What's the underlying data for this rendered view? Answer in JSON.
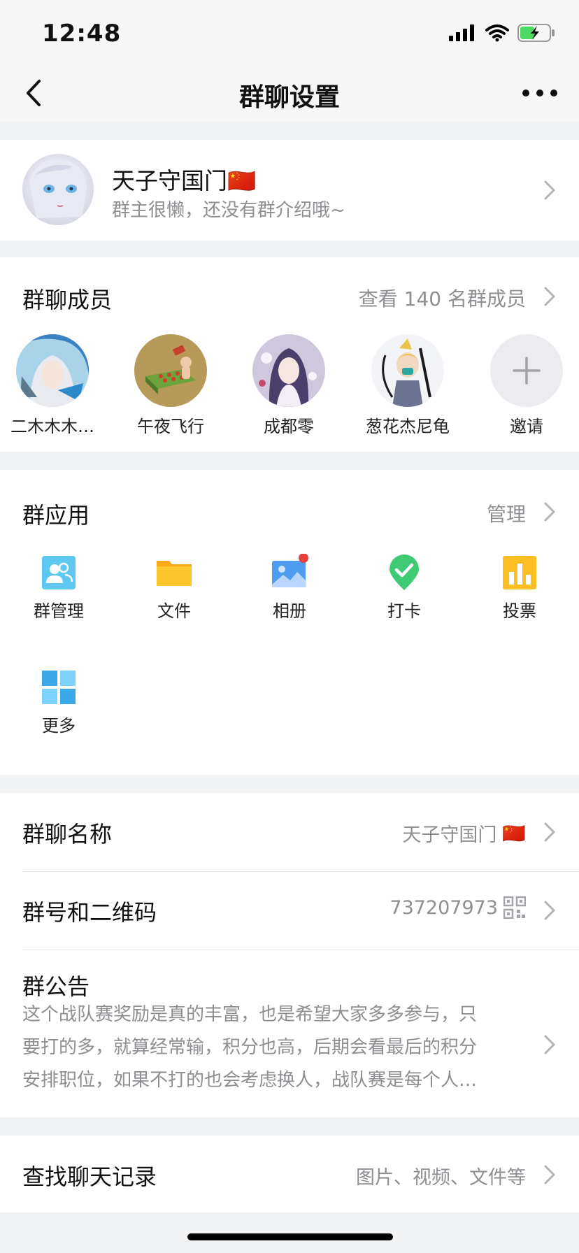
{
  "status_bar": {
    "time": "12:48"
  },
  "nav": {
    "title": "群聊设置",
    "back_icon": "chevron-left-icon",
    "more_icon": "more-dots-icon"
  },
  "group": {
    "name": "天子守国门",
    "flag": "🇨🇳",
    "intro": "群主很懒，还没有群介绍哦~"
  },
  "members": {
    "title": "群聊成员",
    "view_all": "查看 140 名群成员",
    "list": [
      {
        "name": "二木木木…"
      },
      {
        "name": "午夜飞行"
      },
      {
        "name": "成都零"
      },
      {
        "name": "葱花杰尼龟"
      },
      {
        "name": "邀请"
      }
    ]
  },
  "apps": {
    "title": "群应用",
    "manage": "管理",
    "items": [
      {
        "label": "群管理",
        "icon": "group-manage-icon"
      },
      {
        "label": "文件",
        "icon": "folder-icon"
      },
      {
        "label": "相册",
        "icon": "photo-album-icon"
      },
      {
        "label": "打卡",
        "icon": "checkin-icon"
      },
      {
        "label": "投票",
        "icon": "vote-icon"
      },
      {
        "label": "更多",
        "icon": "more-apps-icon"
      }
    ]
  },
  "settings": {
    "name_label": "群聊名称",
    "name_value": "天子守国门",
    "name_flag": "🇨🇳",
    "id_label": "群号和二维码",
    "id_value": "737207973",
    "notice_label": "群公告",
    "notice_lines": [
      "这个战队赛奖励是真的丰富，也是希望大家多多参与，只",
      "要打的多，就算经常输，积分也高，后期会看最后的积分",
      "安排职位，如果不打的也会考虑换人，战队赛是每个人…"
    ]
  },
  "search": {
    "label": "查找聊天记录",
    "hint": "图片、视频、文件等"
  },
  "colors": {
    "accent_red": "#e5413c",
    "folder_yellow": "#fbc52d",
    "check_green": "#3ecb73",
    "manage_blue": "#5fc8f0",
    "vote_yellow": "#fbbf24"
  }
}
